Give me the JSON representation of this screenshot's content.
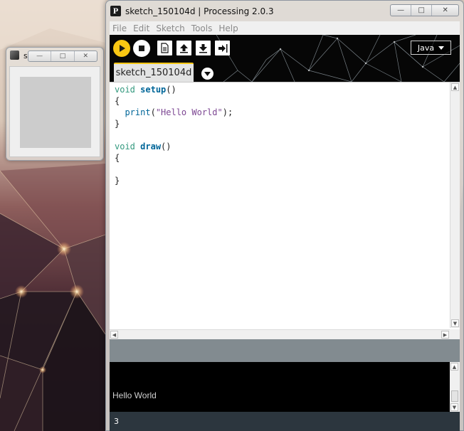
{
  "mini_window": {
    "title": "s",
    "buttons": [
      "—",
      "□",
      "✕"
    ]
  },
  "window": {
    "title": "sketch_150104d | Processing 2.0.3",
    "buttons": [
      "—",
      "□",
      "✕"
    ]
  },
  "menu": [
    "File",
    "Edit",
    "Sketch",
    "Tools",
    "Help"
  ],
  "toolbar": {
    "mode": "Java",
    "icons": [
      "run-icon",
      "stop-icon",
      "new-icon",
      "open-icon",
      "save-icon",
      "export-icon"
    ]
  },
  "tab": {
    "label": "sketch_150104d"
  },
  "code": {
    "line1_kw": "void",
    "line1_fn": "setup",
    "line1_rest": "()",
    "line2": "{",
    "line3_fn": "print",
    "line3_open": "(",
    "line3_str": "\"Hello World\"",
    "line3_close": ");",
    "line4": "}",
    "line6_kw": "void",
    "line6_fn": "draw",
    "line6_rest": "()",
    "line7": "{",
    "line9": "}"
  },
  "console": {
    "output": "Hello World"
  },
  "status": {
    "line_number": "3"
  },
  "colors": {
    "run_button": "#f9c713",
    "tab_accent": "#f5c615",
    "message_bar": "#828b90",
    "status_bar": "#2c363e"
  }
}
